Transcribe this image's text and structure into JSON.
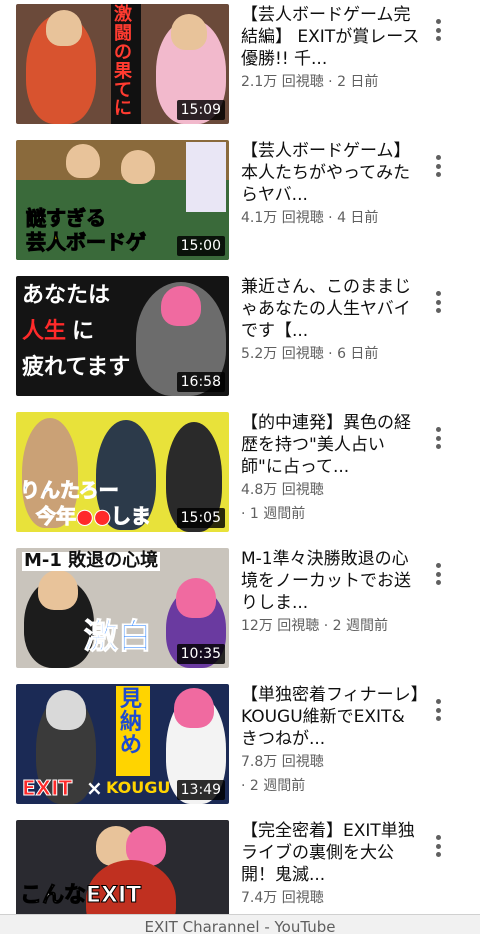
{
  "videos": [
    {
      "title": "【芸人ボードゲーム完結編】 EXITが賞レース優勝!! 千...",
      "meta": "2.1万 回視聴 · 2 日前",
      "meta2": "",
      "duration": "15:09",
      "thumb_text": [
        "激闘の果てに"
      ],
      "thumb_bg": "#6b4a3a"
    },
    {
      "title": "【芸人ボードゲーム】本人たちがやってみたらヤバ...",
      "meta": "4.1万 回視聴 · 4 日前",
      "meta2": "",
      "duration": "15:00",
      "thumb_text": [
        "謎すぎる",
        "芸人ボードゲ"
      ],
      "thumb_bg": "#8a6a3c"
    },
    {
      "title": "兼近さん、このままじゃあなたの人生ヤバイです【...",
      "meta": "5.2万 回視聴 · 6 日前",
      "meta2": "",
      "duration": "16:58",
      "thumb_text": [
        "あなたは",
        "人生",
        "に",
        "疲れてます"
      ],
      "thumb_bg": "#141414"
    },
    {
      "title": "【的中連発】異色の経歴を持つ\"美人占い師\"に占って...",
      "meta": "4.8万 回視聴",
      "meta2": "· 1 週間前",
      "duration": "15:05",
      "thumb_text": [
        "りんたろー",
        "今年●●しま"
      ],
      "thumb_bg": "#e8e23a"
    },
    {
      "title": "M-1準々決勝敗退の心境をノーカットでお送りしま...",
      "meta": "12万 回視聴 · 2 週間前",
      "meta2": "",
      "duration": "10:35",
      "thumb_text": [
        "M-1 敗退の心境",
        "激白"
      ],
      "thumb_bg": "#c9c4bc"
    },
    {
      "title": "【単独密着フィナーレ】KOUGU維新でEXIT&きつねが...",
      "meta": "7.8万 回視聴",
      "meta2": "· 2 週間前",
      "duration": "13:49",
      "thumb_text": [
        "見納め",
        "EXIT",
        "×",
        "KOUGU"
      ],
      "thumb_bg": "#1b2a55"
    },
    {
      "title": "【完全密着】EXIT単独ライブの裏側を大公開！鬼滅...",
      "meta": "7.4万 回視聴",
      "meta2": "",
      "duration": "",
      "thumb_text": [
        "こんなEXIT"
      ],
      "thumb_bg": "#2a2a30"
    }
  ],
  "footer": {
    "title": "EXIT Charannel - YouTube"
  },
  "colors": {
    "text_primary": "#0f0f0f",
    "text_secondary": "#606060",
    "duration_bg": "#000000"
  },
  "icons": {
    "more": "kebab-more-icon"
  }
}
